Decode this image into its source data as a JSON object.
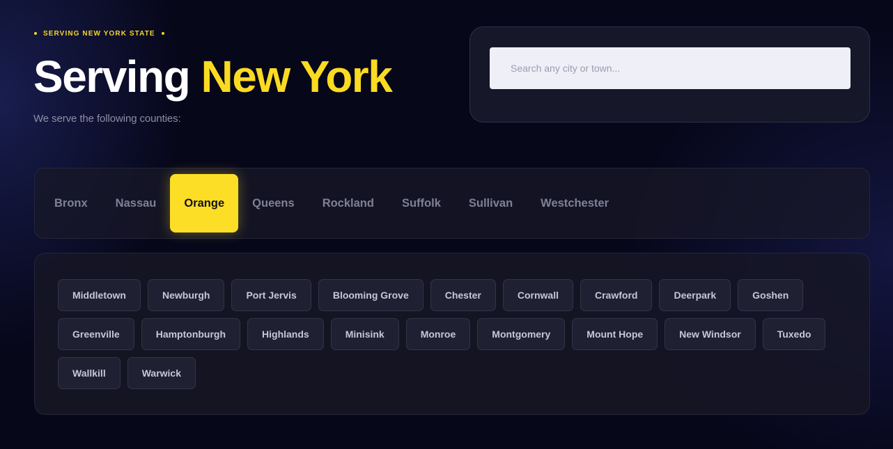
{
  "eyebrow": "SERVING NEW YORK STATE",
  "title": {
    "part1": "Serving",
    "part2": "New York"
  },
  "subtitle": "We serve the following counties:",
  "search": {
    "placeholder": "Search any city or town...",
    "value": ""
  },
  "counties": {
    "active": "Orange",
    "items": [
      "Bronx",
      "Nassau",
      "Orange",
      "Queens",
      "Rockland",
      "Suffolk",
      "Sullivan",
      "Westchester"
    ]
  },
  "towns": [
    "Middletown",
    "Newburgh",
    "Port Jervis",
    "Blooming Grove",
    "Chester",
    "Cornwall",
    "Crawford",
    "Deerpark",
    "Goshen",
    "Greenville",
    "Hamptonburgh",
    "Highlands",
    "Minisink",
    "Monroe",
    "Montgomery",
    "Mount Hope",
    "New Windsor",
    "Tuxedo",
    "Wallkill",
    "Warwick"
  ],
  "colors": {
    "accent": "#fcde26",
    "background": "#07071a",
    "panel": "#17172a",
    "chip": "#1f2031"
  }
}
